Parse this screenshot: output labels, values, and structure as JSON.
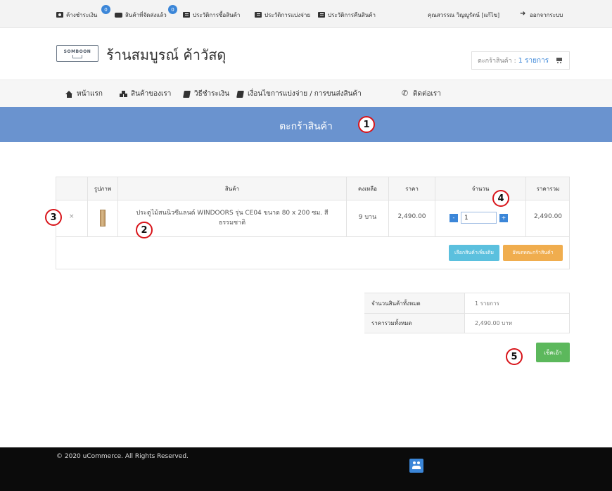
{
  "topbar": {
    "items": [
      {
        "label": "ค้างชำระเงิน",
        "icon": "money-icon",
        "badge": "0"
      },
      {
        "label": "สินค้าที่จัดส่งแล้ว",
        "icon": "truck-icon",
        "badge": "0"
      },
      {
        "label": "ประวัติการซื้อสินค้า",
        "icon": "list-icon"
      },
      {
        "label": "ประวัติการแบ่งจ่าย",
        "icon": "list-icon"
      },
      {
        "label": "ประวัติการคืนสินค้า",
        "icon": "list-icon"
      }
    ],
    "user": "คุณสวรรณ วิญญูรัตน์ [แก้ไข]",
    "logout": "ออกจากระบบ"
  },
  "header": {
    "logo_text": "SOMBOON",
    "shop_name": "ร้านสมบูรณ์ ค้าวัสดุ",
    "cart_label": "ตะกร้าสินค้า :",
    "cart_count": "1 รายการ"
  },
  "nav": {
    "items": [
      {
        "label": "หน้าแรก",
        "icon": "home-icon"
      },
      {
        "label": "สินค้าของเรา",
        "icon": "cubes-icon"
      },
      {
        "label": "วิธีชำระเงิน",
        "icon": "book-icon"
      },
      {
        "label": "เงื่อนไขการแบ่งจ่าย / การขนส่งสินค้า",
        "icon": "book-icon"
      },
      {
        "label": "ติดต่อเรา",
        "icon": "phone-icon"
      }
    ]
  },
  "banner": {
    "title": "ตะกร้าสินค้า"
  },
  "markers": [
    "1",
    "2",
    "3",
    "4",
    "5"
  ],
  "cart_table": {
    "headers": [
      "รูปภาพ",
      "สินค้า",
      "คงเหลือ",
      "ราคา",
      "จำนวน",
      "ราคารวม"
    ],
    "rows": [
      {
        "remove": "×",
        "product": "ประตูไม้สนนิวซีแลนด์ WINDOORS รุ่น CE04 ขนาด 80 x 200 ซม. สีธรรมชาติ",
        "stock": "9 บาน",
        "price": "2,490.00",
        "qty": "1",
        "total": "2,490.00"
      }
    ],
    "qty_minus": "-",
    "qty_plus": "+",
    "btn_more": "เลือกสินค้าเพิ่มเติม",
    "btn_update": "อัพเดทตะกร้าสินค้า"
  },
  "summary": {
    "rows": [
      {
        "label": "จำนวนสินค้าทั้งหมด",
        "value": "1 รายการ"
      },
      {
        "label": "ราคารวมทั้งหมด",
        "value": "2,490.00 บาท"
      }
    ]
  },
  "checkout_label": "เช็คเอ้า",
  "footer": {
    "copyright": "© 2020 uCommerce. All Rights Reserved."
  },
  "colors": {
    "banner": "#6a93cf",
    "accent": "#3b86d8",
    "success": "#5cb85c",
    "warning": "#f0ad4e",
    "info": "#5bc0de",
    "marker": "#d8141a"
  }
}
